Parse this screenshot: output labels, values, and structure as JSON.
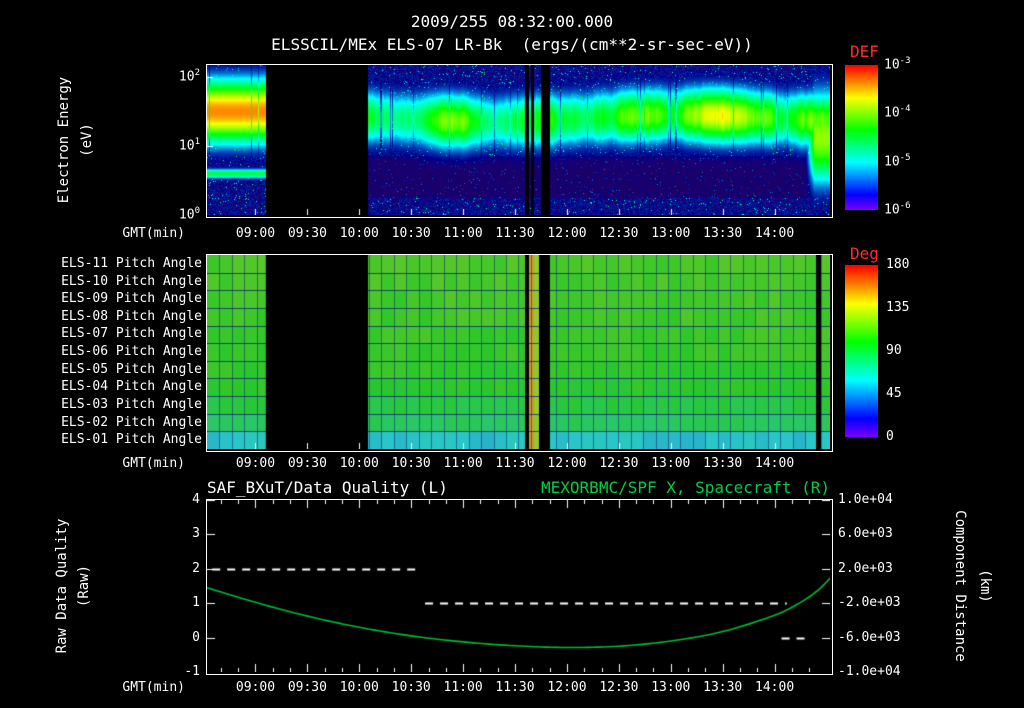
{
  "title": "2009/255 08:32:00.000",
  "subtitle": "ELSSCIL/MEx ELS-07 LR-Bk  (ergs/(cm**2-sr-sec-eV))",
  "time_axis": {
    "label": "GMT(min)",
    "start": "08:32",
    "end": "14:32",
    "ticks": [
      "09:00",
      "09:30",
      "10:00",
      "10:30",
      "11:00",
      "11:30",
      "12:00",
      "12:30",
      "13:00",
      "13:30",
      "14:00"
    ]
  },
  "top_panel": {
    "ylabel_line1": "Electron Energy",
    "ylabel_line2": "(eV)",
    "yticks": [
      {
        "base": "10",
        "exp": "2"
      },
      {
        "base": "10",
        "exp": "1"
      },
      {
        "base": "10",
        "exp": "0"
      }
    ],
    "colorbar": {
      "label": "DEF",
      "ticks": [
        {
          "base": "10",
          "exp": "-3"
        },
        {
          "base": "10",
          "exp": "-4"
        },
        {
          "base": "10",
          "exp": "-5"
        },
        {
          "base": "10",
          "exp": "-6"
        }
      ]
    }
  },
  "middle_panel": {
    "rows": [
      "ELS-11 Pitch Angle",
      "ELS-10 Pitch Angle",
      "ELS-09 Pitch Angle",
      "ELS-08 Pitch Angle",
      "ELS-07 Pitch Angle",
      "ELS-06 Pitch Angle",
      "ELS-05 Pitch Angle",
      "ELS-04 Pitch Angle",
      "ELS-03 Pitch Angle",
      "ELS-02 Pitch Angle",
      "ELS-01 Pitch Angle"
    ],
    "colorbar": {
      "label": "Deg",
      "ticks": [
        "180",
        "135",
        "90",
        "45",
        "0"
      ]
    }
  },
  "bottom_panel": {
    "title_left": "SAF_BXuT/Data Quality (L)",
    "title_right": "MEXORBMC/SPF X, Spacecraft (R)",
    "ylabel_left_line1": "Raw Data Quality",
    "ylabel_left_line2": "(Raw)",
    "ylabel_right_line1": "Component Distance",
    "ylabel_right_line2": "(km)",
    "yticks_left": [
      "4",
      "3",
      "2",
      "1",
      "0",
      "-1"
    ],
    "yticks_right": [
      "1.0e+04",
      "6.0e+03",
      "2.0e+03",
      "-2.0e+03",
      "-6.0e+03",
      "-1.0e+04"
    ]
  },
  "colors": {
    "background": "#000000",
    "text": "#ffffff",
    "colorbar_label": "#ff2a2a",
    "right_title_green": "#00cc44",
    "curve_green": "#00bb33",
    "quality_dash": "#ffffff"
  },
  "chart_data": [
    {
      "type": "heatmap",
      "name": "electron_energy_spectrogram",
      "title": "ELSSCIL/MEx ELS-07 LR-Bk",
      "units": "ergs/(cm**2-sr-sec-eV)",
      "x": {
        "label": "GMT(min)",
        "start": "08:32",
        "end": "14:32"
      },
      "y": {
        "label": "Electron Energy (eV)",
        "scale": "log",
        "min": 1,
        "max": 150
      },
      "z": {
        "label": "DEF",
        "scale": "log",
        "min": 1e-06,
        "max": 0.001
      },
      "band": {
        "center_eV": 26,
        "width_decades": 0.3,
        "peak_level": "~1e-4"
      },
      "bright_interval": {
        "from": "08:32",
        "to": "09:06",
        "peak_eV": [
          25,
          70
        ],
        "level": "~1e-3"
      },
      "low_energy_line": {
        "energy_eV": 4,
        "from": "08:32",
        "to": "09:06"
      },
      "right_broadening": {
        "from": "14:17",
        "to": "14:32",
        "energy_eV": [
          3,
          60
        ]
      },
      "data_gaps": [
        [
          "09:06",
          "10:05"
        ],
        [
          "11:36",
          "11:38"
        ],
        [
          "11:39",
          "11:41"
        ],
        [
          "11:45",
          "11:50"
        ]
      ]
    },
    {
      "type": "heatmap",
      "name": "pitch_angle_panels",
      "rows": [
        "ELS-11 Pitch Angle",
        "ELS-10 Pitch Angle",
        "ELS-09 Pitch Angle",
        "ELS-08 Pitch Angle",
        "ELS-07 Pitch Angle",
        "ELS-06 Pitch Angle",
        "ELS-05 Pitch Angle",
        "ELS-04 Pitch Angle",
        "ELS-03 Pitch Angle",
        "ELS-02 Pitch Angle",
        "ELS-01 Pitch Angle"
      ],
      "z": {
        "label": "Deg",
        "min": 0,
        "max": 180
      },
      "row_mean_pitch_deg": [
        108,
        107,
        106,
        105,
        104,
        103,
        101,
        99,
        93,
        86,
        58
      ],
      "stripes": [
        {
          "from": "11:38",
          "to": "11:41",
          "pitch_deg": 150
        },
        {
          "from": "11:41",
          "to": "11:44",
          "pitch_deg": 127
        }
      ],
      "data_gaps": [
        [
          "09:06",
          "10:05"
        ],
        [
          "11:36",
          "11:38"
        ],
        [
          "11:44",
          "11:50"
        ],
        [
          "14:24",
          "14:27"
        ]
      ]
    },
    {
      "type": "line",
      "name": "quality_and_distance",
      "x": {
        "label": "GMT(min)",
        "start": "08:32",
        "end": "14:32"
      },
      "left_axis": {
        "label": "Raw Data Quality (Raw)",
        "min": -1,
        "max": 4,
        "series": "SAF_BXuT/Data Quality (L)"
      },
      "right_axis": {
        "label": "Component Distance (km)",
        "min": -10000,
        "max": 10000,
        "series": "MEXORBMC/SPF X, Spacecraft (R)"
      },
      "quality_segments": [
        {
          "value": 2,
          "from": "08:35",
          "to": "10:35"
        },
        {
          "value": 1,
          "from": "10:38",
          "to": "14:07"
        },
        {
          "value": 0,
          "from": "14:04",
          "to": "14:19"
        }
      ],
      "distance_points": [
        [
          "08:32",
          -200
        ],
        [
          "09:00",
          -1900
        ],
        [
          "09:30",
          -3500
        ],
        [
          "10:00",
          -4800
        ],
        [
          "10:30",
          -5800
        ],
        [
          "11:00",
          -6500
        ],
        [
          "11:30",
          -6950
        ],
        [
          "12:00",
          -7150
        ],
        [
          "12:30",
          -7000
        ],
        [
          "13:00",
          -6400
        ],
        [
          "13:30",
          -5300
        ],
        [
          "14:00",
          -3400
        ],
        [
          "14:15",
          -1900
        ],
        [
          "14:25",
          -500
        ],
        [
          "14:32",
          900
        ]
      ]
    }
  ]
}
